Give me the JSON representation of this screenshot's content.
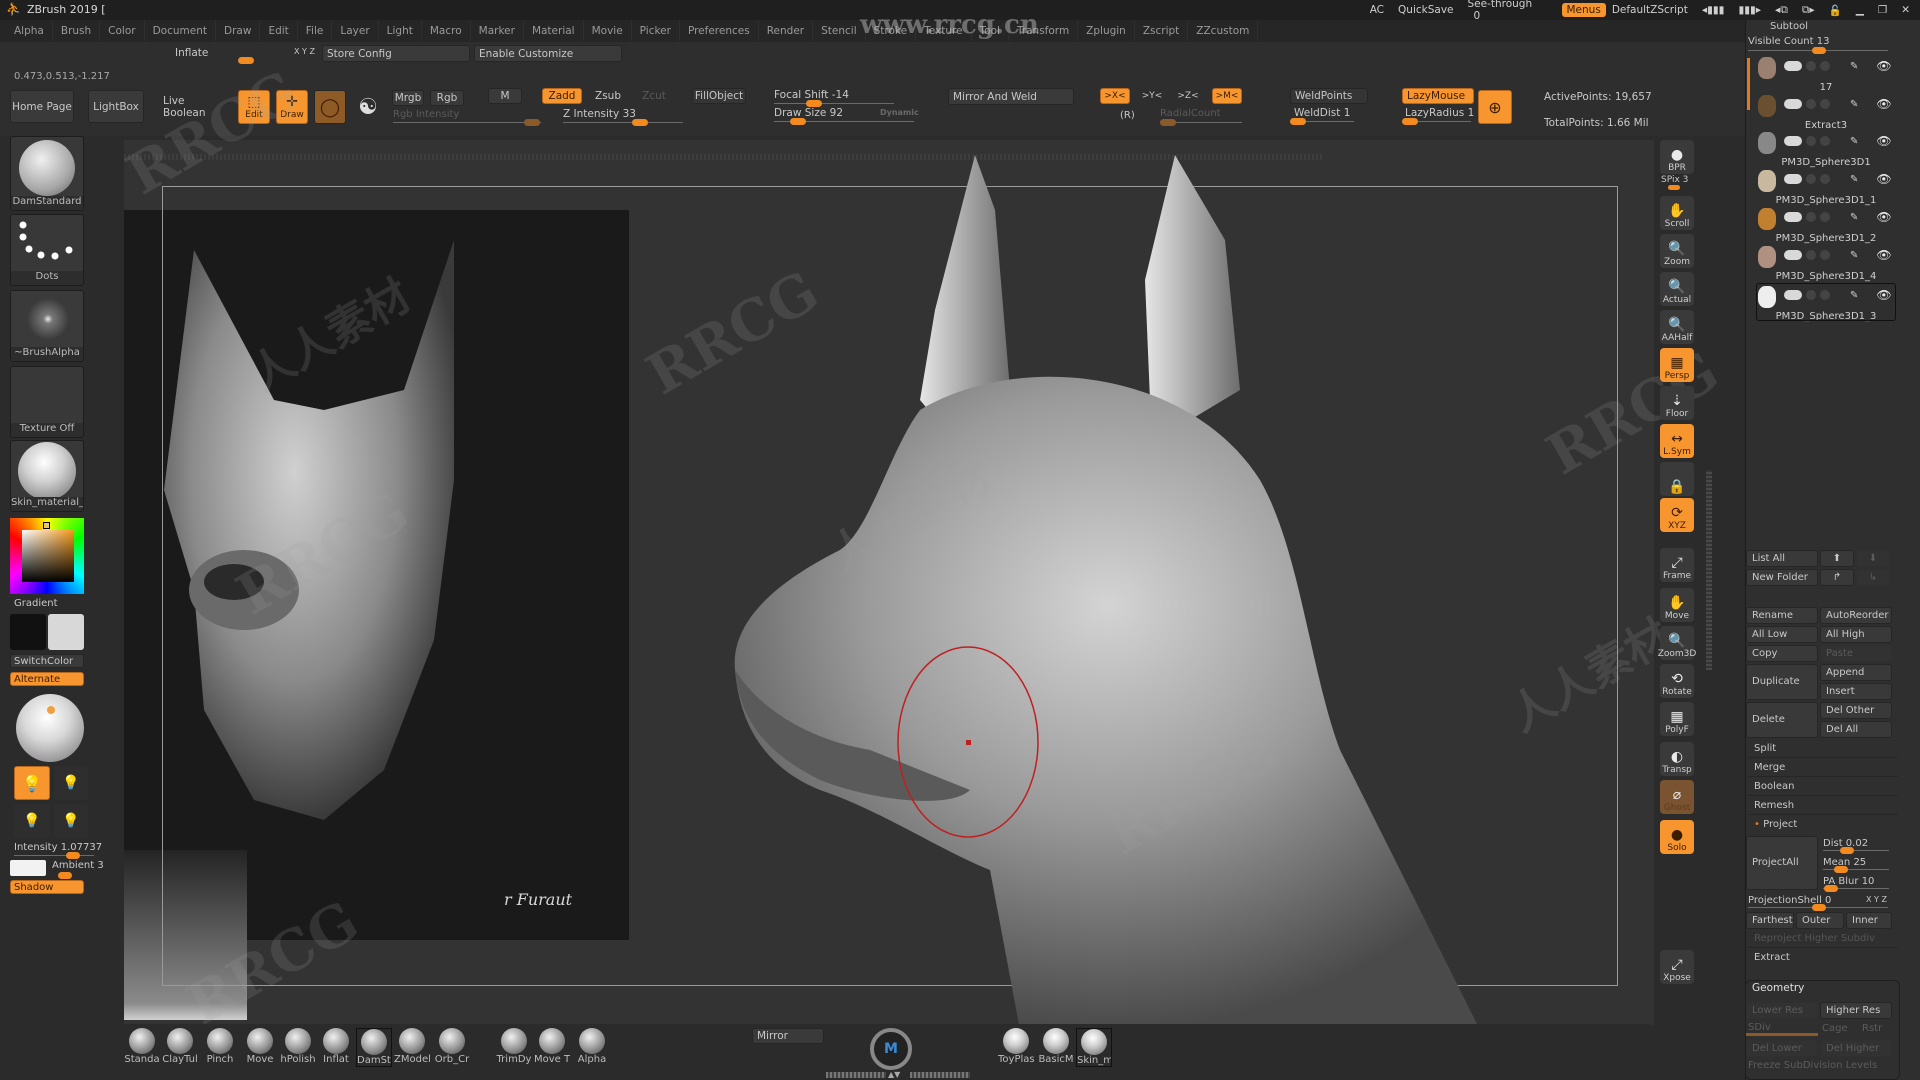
{
  "app": {
    "title": "ZBrush 2019 ["
  },
  "menubar": {
    "items": [
      "Alpha",
      "Brush",
      "Color",
      "Document",
      "Draw",
      "Edit",
      "File",
      "Layer",
      "Light",
      "Macro",
      "Marker",
      "Material",
      "Movie",
      "Picker",
      "Preferences",
      "Render",
      "Stencil",
      "Stroke",
      "Texture",
      "Tool",
      "Transform",
      "Zplugin",
      "Zscript",
      "ZZcustom"
    ]
  },
  "topright": {
    "ac": "AC",
    "quicksave": "QuickSave",
    "see_through_label": "See-through",
    "see_through_value": "0",
    "menus": "Menus",
    "default_zscript": "DefaultZScript"
  },
  "watermark": {
    "url": "www.rrcg.cn",
    "brand": "RRCG",
    "cn": "人人素材"
  },
  "toolbar_row2": {
    "inflate_label": "Inflate",
    "xyz_label": "X Y Z",
    "store_config": "Store Config",
    "enable_customize": "Enable Customize"
  },
  "coords": "0.473,0.513,-1.217",
  "toolbar": {
    "home_page": "Home Page",
    "lightbox": "LightBox",
    "live_boolean": "Live Boolean",
    "edit": "Edit",
    "draw": "Draw",
    "mrgb": "Mrgb",
    "rgb": "Rgb",
    "m": "M",
    "rgb_intensity": "Rgb Intensity",
    "zadd": "Zadd",
    "zsub": "Zsub",
    "zcut": "Zcut",
    "z_intensity_label": "Z Intensity",
    "z_intensity_value": "33",
    "fillobject": "FillObject",
    "focal_shift_label": "Focal Shift",
    "focal_shift_value": "-14",
    "draw_size_label": "Draw Size",
    "draw_size_value": "92",
    "dynamic": "Dynamic",
    "mirror_and_weld": "Mirror And Weld",
    "x_sym": ">X<",
    "y_sym": ">Y<",
    "z_sym": ">Z<",
    "m_sym": ">M<",
    "r": "(R)",
    "radial_count": "RadialCount",
    "weld_points": "WeldPoints",
    "weld_dist_label": "WeldDist",
    "weld_dist_value": "1",
    "lazymouse": "LazyMouse",
    "lazyradius_label": "LazyRadius",
    "lazyradius_value": "1",
    "active_points": "ActivePoints: 19,657",
    "total_points": "TotalPoints: 1.66 Mil"
  },
  "left_shelf": {
    "brush": "DamStandard",
    "stroke": "Dots",
    "alpha": "~BrushAlpha",
    "texture": "Texture Off",
    "material": "Skin_material_A",
    "gradient": "Gradient",
    "switch_color": "SwitchColor",
    "alternate": "Alternate",
    "intensity_label": "Intensity",
    "intensity_value": "1.07737",
    "ambient_label": "Ambient",
    "ambient_value": "3",
    "shadow": "Shadow"
  },
  "canvas": {
    "signature": "r Furaut"
  },
  "right_toolbar": [
    {
      "name": "bpr",
      "label": "BPR",
      "icon": "●",
      "on": false
    },
    {
      "name": "scroll",
      "label": "Scroll",
      "icon": "✋",
      "on": false
    },
    {
      "name": "zoom",
      "label": "Zoom",
      "icon": "🔍",
      "on": false
    },
    {
      "name": "actual",
      "label": "Actual",
      "icon": "🔍",
      "on": false
    },
    {
      "name": "aahalf",
      "label": "AAHalf",
      "icon": "🔍",
      "on": false
    },
    {
      "name": "persp",
      "label": "Persp",
      "icon": "▦",
      "on": true
    },
    {
      "name": "floor",
      "label": "Floor",
      "icon": "⇣",
      "on": false
    },
    {
      "name": "lsym",
      "label": "L.Sym",
      "icon": "↔",
      "on": true
    },
    {
      "name": "camera-lock",
      "label": "",
      "icon": "🔒",
      "on": false
    },
    {
      "name": "rotate-xyz",
      "label": "XYZ",
      "icon": "⟳",
      "on": true
    },
    {
      "name": "frame",
      "label": "Frame",
      "icon": "⤢",
      "on": false
    },
    {
      "name": "move",
      "label": "Move",
      "icon": "✋",
      "on": false
    },
    {
      "name": "zoom3d",
      "label": "Zoom3D",
      "icon": "🔍",
      "on": false
    },
    {
      "name": "rotate",
      "label": "Rotate",
      "icon": "⟲",
      "on": false
    },
    {
      "name": "polyf",
      "label": "PolyF",
      "icon": "▦",
      "on": false
    },
    {
      "name": "transp",
      "label": "Transp",
      "icon": "◐",
      "on": false
    },
    {
      "name": "ghost",
      "label": "Ghost",
      "icon": "⌀",
      "on": false
    },
    {
      "name": "solo",
      "label": "Solo",
      "icon": "●",
      "on": true
    },
    {
      "name": "xpose",
      "label": "Xpose",
      "icon": "⤢",
      "on": false
    }
  ],
  "spix": {
    "label": "SPix",
    "value": "3"
  },
  "subtool": {
    "header": "Subtool",
    "visible_count_label": "Visible Count",
    "visible_count_value": "13",
    "items": [
      "17",
      "Extract3",
      "PM3D_Sphere3D1",
      "PM3D_Sphere3D1_1",
      "PM3D_Sphere3D1_2",
      "PM3D_Sphere3D1_4",
      "PM3D_Sphere3D1_3"
    ],
    "list_all": "List All",
    "new_folder": "New Folder",
    "rename": "Rename",
    "auto_reorder": "AutoReorder",
    "all_low": "All Low",
    "all_high": "All High",
    "copy": "Copy",
    "paste": "Paste",
    "duplicate": "Duplicate",
    "append": "Append",
    "insert": "Insert",
    "delete": "Delete",
    "del_other": "Del Other",
    "del_all": "Del All",
    "split": "Split",
    "merge": "Merge",
    "boolean": "Boolean",
    "remesh": "Remesh",
    "project": "Project",
    "project_all": "ProjectAll",
    "dist_label": "Dist",
    "dist_value": "0.02",
    "mean_label": "Mean",
    "mean_value": "25",
    "pa_blur_label": "PA Blur",
    "pa_blur_value": "10",
    "projection_shell_label": "ProjectionShell",
    "projection_shell_value": "0",
    "farthest": "Farthest",
    "outer": "Outer",
    "inner": "Inner",
    "reproject": "Reproject Higher Subdiv",
    "extract": "Extract"
  },
  "geometry": {
    "header": "Geometry",
    "lower_res": "Lower Res",
    "higher_res": "Higher Res",
    "sdiv": "SDiv",
    "cage": "Cage",
    "rstr": "Rstr",
    "del_lower": "Del Lower",
    "del_higher": "Del Higher",
    "freeze": "Freeze SubDivision Levels"
  },
  "bottom_brushes": [
    "Standa",
    "ClayTul",
    "Pinch",
    "Move",
    "hPolish",
    "Inflat",
    "DamSta",
    "ZModel",
    "Orb_Cr",
    "TrimDy",
    "Move T",
    "Alpha"
  ],
  "bottom_mirror": "Mirror",
  "bottom_materials": [
    "ToyPlas",
    "BasicM",
    "Skin_m"
  ]
}
